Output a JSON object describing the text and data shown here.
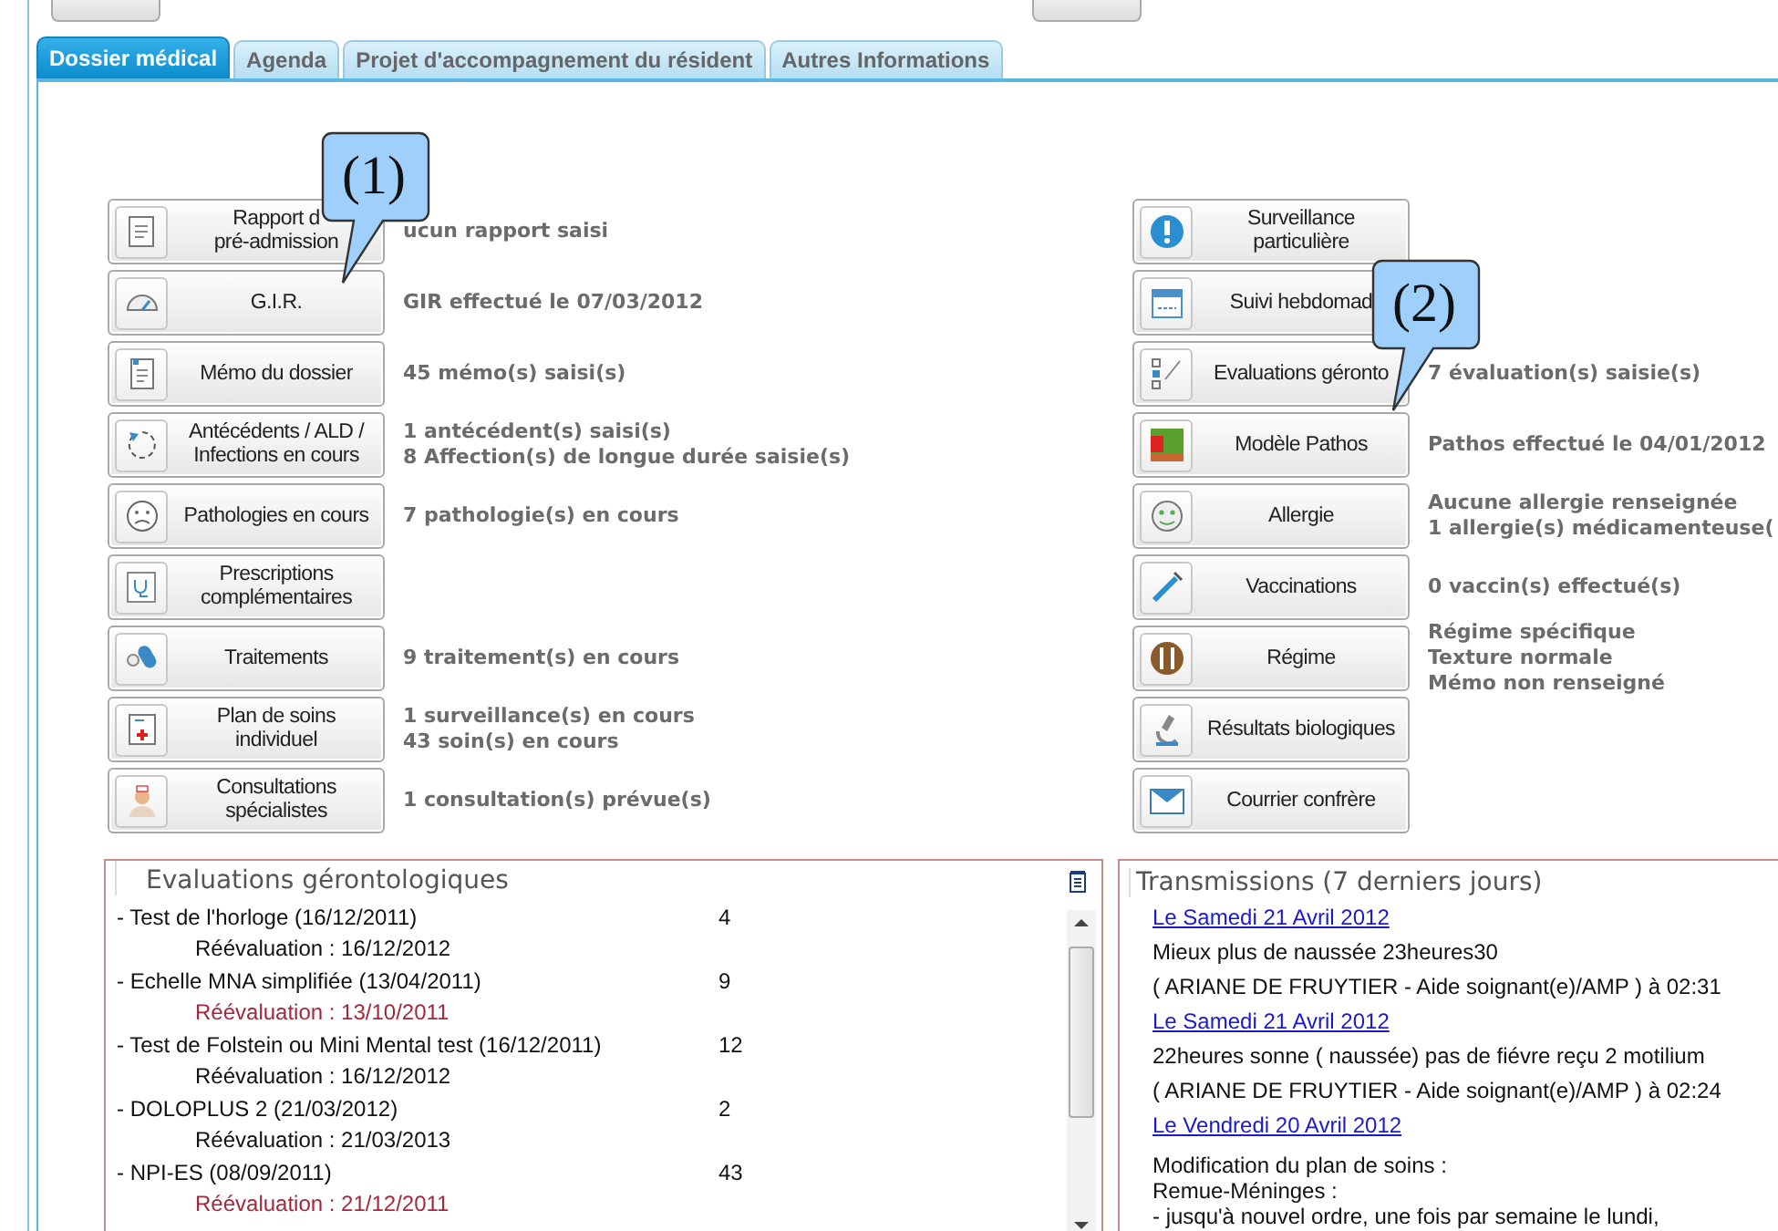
{
  "tabs": [
    {
      "label": "Dossier médical",
      "selected": true
    },
    {
      "label": "Agenda",
      "selected": false
    },
    {
      "label": "Projet d'accompagnement du résident",
      "selected": false
    },
    {
      "label": "Autres Informations",
      "selected": false
    }
  ],
  "left_buttons": [
    {
      "label": "Rapport d\npré-admission",
      "status": "ucun rapport saisi"
    },
    {
      "label": "G.I.R.",
      "status": "GIR effectué le 07/03/2012"
    },
    {
      "label": "Mémo du dossier",
      "status": "45 mémo(s) saisi(s)"
    },
    {
      "label": "Antécédents / ALD /\nInfections en cours",
      "status": "1 antécédent(s) saisi(s)\n8 Affection(s) de longue durée saisie(s)"
    },
    {
      "label": "Pathologies en cours",
      "status": "7 pathologie(s) en cours"
    },
    {
      "label": "Prescriptions\ncomplémentaires"
    },
    {
      "label": "Traitements",
      "status": "9 traitement(s) en cours"
    },
    {
      "label": "Plan de soins\nindividuel",
      "status": "1 surveillance(s) en cours\n43 soin(s) en cours"
    },
    {
      "label": "Consultations\nspécialistes",
      "status": "1 consultation(s) prévue(s)"
    }
  ],
  "right_buttons": [
    {
      "label": "Surveillance\nparticulière"
    },
    {
      "label": "Suivi hebdomad"
    },
    {
      "label": "Evaluations géronto",
      "status": "7 évaluation(s) saisie(s)"
    },
    {
      "label": "Modèle Pathos",
      "status": "Pathos effectué le 04/01/2012"
    },
    {
      "label": "Allergie",
      "status": "Aucune allergie renseignée\n1 allergie(s) médicamenteuse("
    },
    {
      "label": "Vaccinations",
      "status": "0 vaccin(s) effectué(s)"
    },
    {
      "label": "Régime",
      "status": "Régime spécifique\nTexture normale\nMémo non renseigné"
    },
    {
      "label": "Résultats biologiques"
    },
    {
      "label": "Courrier confrère"
    }
  ],
  "callouts": [
    {
      "label": "(1)"
    },
    {
      "label": "(2)"
    }
  ],
  "evaluations": {
    "title": "Evaluations gérontologiques",
    "rows": [
      {
        "name": "- Test de l'horloge (16/12/2011)",
        "score": "4",
        "reevaluation": "Réévaluation : 16/12/2012",
        "overdue": false
      },
      {
        "name": "- Echelle MNA simplifiée (13/04/2011)",
        "score": "9",
        "reevaluation": "Réévaluation : 13/10/2011",
        "overdue": true
      },
      {
        "name": "- Test de Folstein ou Mini Mental test (16/12/2011)",
        "score": "12",
        "reevaluation": "Réévaluation : 16/12/2012",
        "overdue": false
      },
      {
        "name": "- DOLOPLUS 2 (21/03/2012)",
        "score": "2",
        "reevaluation": "Réévaluation : 21/03/2013",
        "overdue": false
      },
      {
        "name": "- NPI-ES (08/09/2011)",
        "score": "43",
        "reevaluation": "Réévaluation : 21/12/2011",
        "overdue": true
      }
    ]
  },
  "transmissions": {
    "title": "Transmissions (7 derniers jours)",
    "entries": [
      {
        "kind": "date",
        "text": "Le Samedi 21 Avril 2012"
      },
      {
        "kind": "note",
        "text": "Mieux plus de naussée 23heures30"
      },
      {
        "kind": "author",
        "text": "( ARIANE DE FRUYTIER - Aide soignant(e)/AMP ) à 02:31"
      },
      {
        "kind": "date",
        "text": "Le Samedi 21 Avril 2012"
      },
      {
        "kind": "note",
        "text": "22heures sonne ( naussée) pas de fiévre reçu 2 motilium"
      },
      {
        "kind": "author",
        "text": "( ARIANE DE FRUYTIER - Aide soignant(e)/AMP ) à 02:24"
      },
      {
        "kind": "date",
        "text": "Le Vendredi 20 Avril 2012"
      },
      {
        "kind": "note",
        "text": "Modification du plan de soins :\nRemue-Méninges :\n- jusqu'à nouvel ordre, une fois par semaine le lundi,"
      }
    ]
  }
}
